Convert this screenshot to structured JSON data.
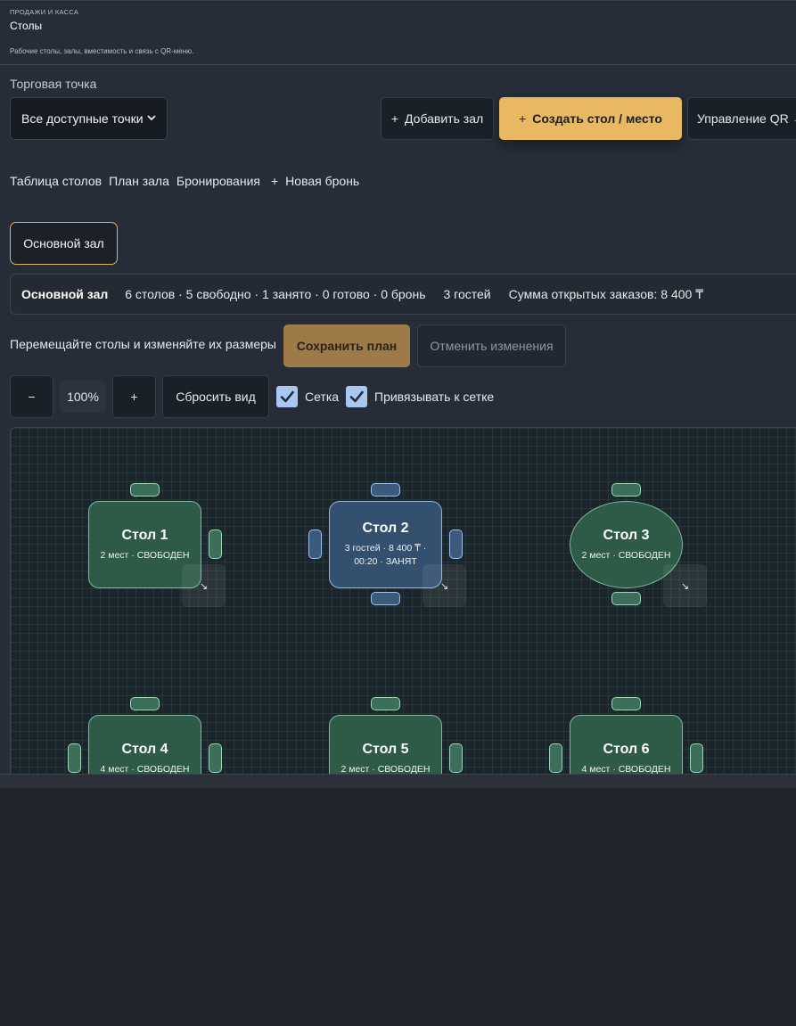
{
  "header": {
    "eyebrow": "ПРОДАЖИ И КАССА",
    "title": "Столы",
    "subtitle": "Рабочие столы, залы, вместимость и связь с QR-меню."
  },
  "outlet": {
    "label": "Торговая точка",
    "selected": "Все доступные точки"
  },
  "actions": {
    "add_hall": "Добавить зал",
    "create_table": "Создать стол / место",
    "manage_qr": "Управление QR →",
    "plus": "+"
  },
  "tabs": [
    "Таблица столов",
    "План зала",
    "Бронирования",
    "+",
    "Новая бронь"
  ],
  "halls": [
    "Основной зал"
  ],
  "summary": {
    "hall": "Основной зал",
    "stats": "6 столов · 5 свободно · 1 занято · 0 готово · 0 бронь",
    "guests": "3 гостей",
    "open_orders": "Сумма открытых заказов: 8 400 ₸"
  },
  "plan": {
    "hint": "Перемещайте столы и изменяйте их размеры",
    "save": "Сохранить план",
    "cancel": "Отменить изменения",
    "zoom_out": "−",
    "zoom": "100%",
    "zoom_in": "+",
    "reset": "Сбросить вид",
    "grid_label": "Сетка",
    "grid_checked": true,
    "snap_label": "Привязывать к сетке",
    "snap_checked": true
  },
  "tables": [
    {
      "name": "Стол 1",
      "status_line1": "2 мест · СВОБОДЕН",
      "status_line2": "",
      "state": "free",
      "shape": "rect"
    },
    {
      "name": "Стол 2",
      "status_line1": "3 гостей · 8 400 ₸ ·",
      "status_line2": "00:20 · ЗАНЯТ",
      "state": "busy",
      "shape": "rect"
    },
    {
      "name": "Стол 3",
      "status_line1": "2 мест · СВОБОДЕН",
      "status_line2": "",
      "state": "free",
      "shape": "round"
    },
    {
      "name": "Стол 4",
      "status_line1": "4 мест · СВОБОДЕН",
      "status_line2": "",
      "state": "free",
      "shape": "rect"
    },
    {
      "name": "Стол 5",
      "status_line1": "2 мест · СВОБОДЕН",
      "status_line2": "",
      "state": "free",
      "shape": "rect"
    },
    {
      "name": "Стол 6",
      "status_line1": "4 мест · СВОБОДЕН",
      "status_line2": "",
      "state": "free",
      "shape": "rect"
    }
  ],
  "resize_handle_glyph": "↘",
  "select_icon": "chevron-down-icon",
  "colors": {
    "accent": "#e9b862",
    "free_table": "#2e5a48",
    "busy_table": "#33506e",
    "checkbox": "#a9c8f0"
  }
}
